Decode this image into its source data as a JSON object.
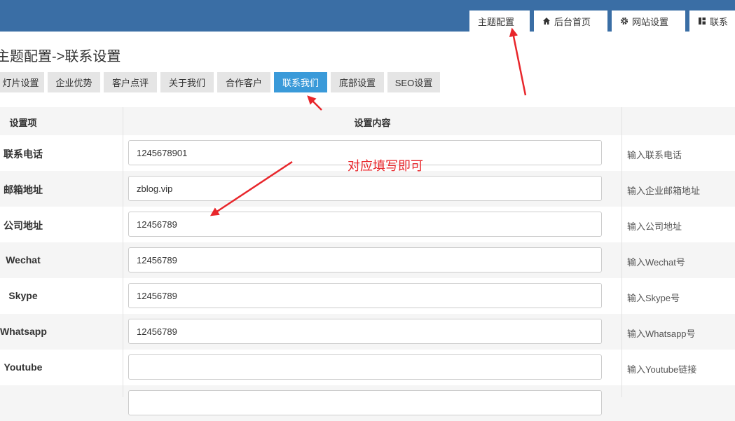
{
  "header": {
    "tabs": [
      {
        "label": "主题配置",
        "icon": ""
      },
      {
        "label": "后台首页",
        "icon": "home-icon"
      },
      {
        "label": "网站设置",
        "icon": "gear-icon"
      },
      {
        "label": "联系",
        "icon": "layout-icon"
      }
    ]
  },
  "page": {
    "title": "主题配置->联系设置"
  },
  "subtabs": [
    {
      "label": "灯片设置"
    },
    {
      "label": "企业优势"
    },
    {
      "label": "客户点评"
    },
    {
      "label": "关于我们"
    },
    {
      "label": "合作客户"
    },
    {
      "label": "联系我们",
      "active": true
    },
    {
      "label": "底部设置"
    },
    {
      "label": "SEO设置"
    }
  ],
  "table": {
    "headers": {
      "item": "设置项",
      "content": "设置内容"
    },
    "rows": [
      {
        "label": "联系电话",
        "value": "1245678901",
        "hint": "输入联系电话"
      },
      {
        "label": "邮箱地址",
        "value": "zblog.vip",
        "hint": "输入企业邮箱地址"
      },
      {
        "label": "公司地址",
        "value": "12456789",
        "hint": "输入公司地址"
      },
      {
        "label": "Wechat",
        "value": "12456789",
        "hint": "输入Wechat号"
      },
      {
        "label": "Skype",
        "value": "12456789",
        "hint": "输入Skype号"
      },
      {
        "label": "Whatsapp",
        "value": "12456789",
        "hint": "输入Whatsapp号"
      },
      {
        "label": "Youtube",
        "value": "",
        "hint": "输入Youtube链接"
      },
      {
        "label": "",
        "value": "",
        "hint": ""
      }
    ]
  },
  "annotation": {
    "text": "对应填写即可",
    "color": "#e8262b"
  },
  "colors": {
    "header_bg": "#3a6ea5",
    "active_tab": "#3a9ad9"
  }
}
